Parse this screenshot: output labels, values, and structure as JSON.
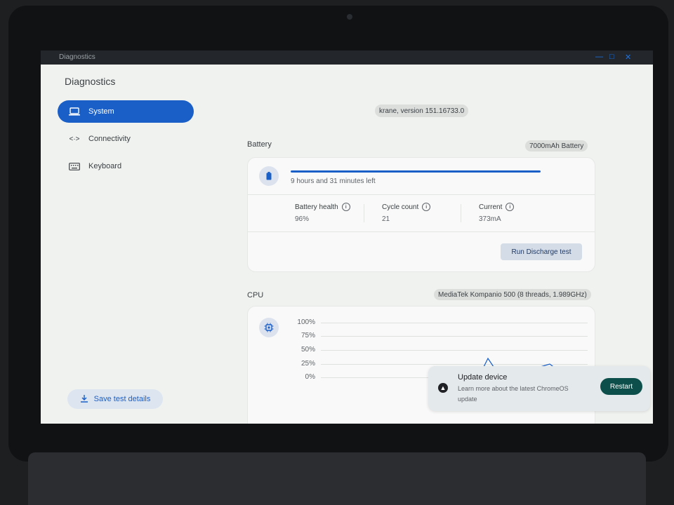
{
  "window": {
    "title": "Diagnostics"
  },
  "app": {
    "title": "Diagnostics"
  },
  "sidebar": {
    "items": [
      {
        "label": "System",
        "icon": "laptop-icon",
        "active": true
      },
      {
        "label": "Connectivity",
        "icon": "connectivity-icon",
        "active": false
      },
      {
        "label": "Keyboard",
        "icon": "keyboard-icon",
        "active": false
      }
    ],
    "save_button": {
      "label": "Save test details",
      "icon": "download-icon"
    }
  },
  "system": {
    "version_chip": "krane, version 151.16733.0"
  },
  "battery": {
    "label": "Battery",
    "chip": "7000mAh Battery",
    "time_left": "9 hours and 31 minutes left",
    "charge_fraction": 1.0,
    "metrics": [
      {
        "name": "Battery health",
        "value": "96%"
      },
      {
        "name": "Cycle count",
        "value": "21"
      },
      {
        "name": "Current",
        "value": "373mA"
      }
    ],
    "run_test_label": "Run Discharge test"
  },
  "cpu": {
    "label": "CPU",
    "chip": "MediaTek Kompanio 500 (8 threads, 1.989GHz)",
    "y_ticks": [
      "100%",
      "75%",
      "50%",
      "25%",
      "0%"
    ]
  },
  "toast": {
    "title": "Update device",
    "message": "Learn more about the latest ChromeOS update",
    "action": "Restart"
  },
  "colors": {
    "accent": "#1a5fc8",
    "restart": "#0d4f4a"
  }
}
